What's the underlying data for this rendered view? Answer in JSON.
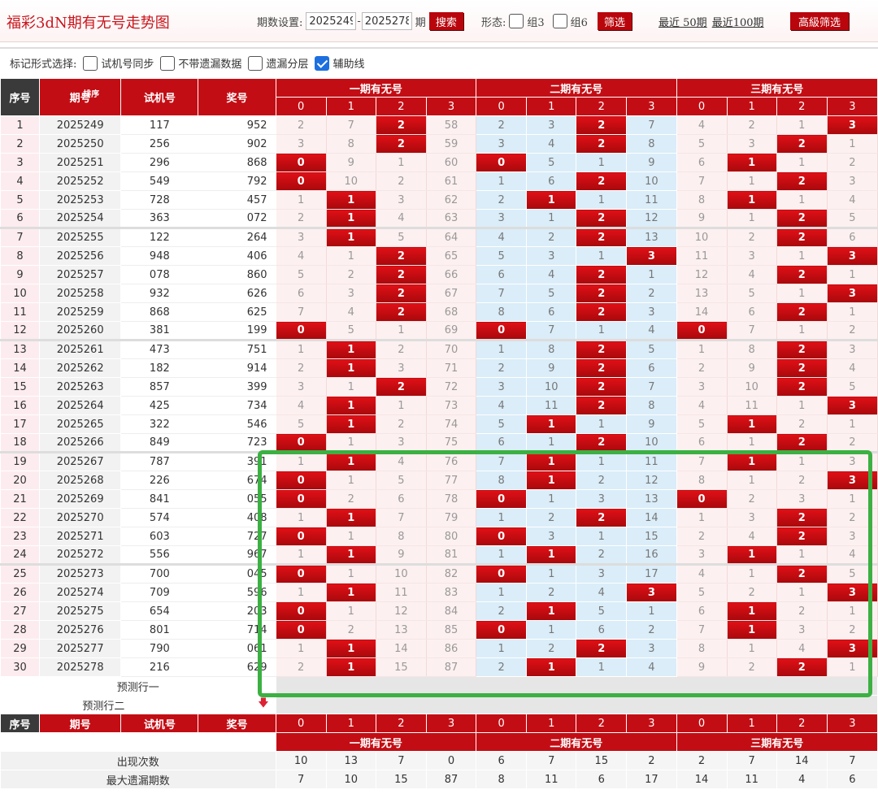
{
  "header": {
    "title": "福彩3dN期有无号走势图",
    "period_label": "期数设置:",
    "period_from": "2025249",
    "period_to": "2025278",
    "period_unit": "期",
    "search_label": "搜索",
    "form_label": "形态:",
    "form_opt1": "组3",
    "form_opt2": "组6",
    "filter_label": "筛选",
    "recent50": "最近 50期",
    "recent100": "最近100期",
    "adv_filter": "高級筛选"
  },
  "mark": {
    "label": "标记形式选择:",
    "opt1": "试机号同步",
    "opt2": "不带遗漏数据",
    "opt3": "遗漏分层",
    "opt4": "辅助线",
    "opt4_checked": true
  },
  "table": {
    "col_seq": "序号",
    "col_period": "期号",
    "col_sort": "排序",
    "col_test": "试机号",
    "col_draw": "奖号",
    "groups": [
      "一期有无号",
      "二期有无号",
      "三期有无号"
    ],
    "digits": [
      "0",
      "1",
      "2",
      "3"
    ],
    "pred1": "预测行一",
    "pred2": "预测行二",
    "stat_labels": [
      "出现次数",
      "最大遗漏期数"
    ],
    "stats": [
      [
        "10",
        "13",
        "7",
        "0",
        "6",
        "7",
        "15",
        "2",
        "2",
        "7",
        "14",
        "7"
      ],
      [
        "7",
        "10",
        "15",
        "87",
        "8",
        "11",
        "6",
        "17",
        "14",
        "11",
        "4",
        "6"
      ]
    ],
    "rows": [
      {
        "s": "1",
        "p": "2025249",
        "t": "117",
        "d": "952",
        "v": [
          "2",
          "7",
          "2",
          "58",
          "2",
          "3",
          "2",
          "7",
          "4",
          "2",
          "1",
          "3"
        ],
        "h": [
          2,
          6,
          11
        ]
      },
      {
        "s": "2",
        "p": "2025250",
        "t": "256",
        "d": "902",
        "v": [
          "3",
          "8",
          "2",
          "59",
          "3",
          "4",
          "2",
          "8",
          "5",
          "3",
          "2",
          "1"
        ],
        "h": [
          2,
          6,
          10
        ]
      },
      {
        "s": "3",
        "p": "2025251",
        "t": "296",
        "d": "868",
        "v": [
          "0",
          "9",
          "1",
          "60",
          "0",
          "5",
          "1",
          "9",
          "6",
          "1",
          "1",
          "2"
        ],
        "h": [
          0,
          4,
          9
        ]
      },
      {
        "s": "4",
        "p": "2025252",
        "t": "549",
        "d": "792",
        "v": [
          "0",
          "10",
          "2",
          "61",
          "1",
          "6",
          "2",
          "10",
          "7",
          "1",
          "2",
          "3"
        ],
        "h": [
          0,
          6,
          10
        ]
      },
      {
        "s": "5",
        "p": "2025253",
        "t": "728",
        "d": "457",
        "v": [
          "1",
          "1",
          "3",
          "62",
          "2",
          "1",
          "1",
          "11",
          "8",
          "1",
          "1",
          "4"
        ],
        "h": [
          1,
          5,
          9
        ]
      },
      {
        "s": "6",
        "p": "2025254",
        "t": "363",
        "d": "072",
        "v": [
          "2",
          "1",
          "4",
          "63",
          "3",
          "1",
          "2",
          "12",
          "9",
          "1",
          "2",
          "5"
        ],
        "h": [
          1,
          6,
          10
        ]
      },
      {
        "s": "7",
        "p": "2025255",
        "t": "122",
        "d": "264",
        "v": [
          "3",
          "1",
          "5",
          "64",
          "4",
          "2",
          "2",
          "13",
          "10",
          "2",
          "2",
          "6"
        ],
        "h": [
          1,
          6,
          10
        ]
      },
      {
        "s": "8",
        "p": "2025256",
        "t": "948",
        "d": "406",
        "v": [
          "4",
          "1",
          "2",
          "65",
          "5",
          "3",
          "1",
          "3",
          "11",
          "3",
          "1",
          "3"
        ],
        "h": [
          2,
          7,
          11
        ]
      },
      {
        "s": "9",
        "p": "2025257",
        "t": "078",
        "d": "860",
        "v": [
          "5",
          "2",
          "2",
          "66",
          "6",
          "4",
          "2",
          "1",
          "12",
          "4",
          "2",
          "1"
        ],
        "h": [
          2,
          6,
          10
        ]
      },
      {
        "s": "10",
        "p": "2025258",
        "t": "932",
        "d": "626",
        "v": [
          "6",
          "3",
          "2",
          "67",
          "7",
          "5",
          "2",
          "2",
          "13",
          "5",
          "1",
          "3"
        ],
        "h": [
          2,
          6,
          11
        ]
      },
      {
        "s": "11",
        "p": "2025259",
        "t": "868",
        "d": "625",
        "v": [
          "7",
          "4",
          "2",
          "68",
          "8",
          "6",
          "2",
          "3",
          "14",
          "6",
          "2",
          "1"
        ],
        "h": [
          2,
          6,
          10
        ]
      },
      {
        "s": "12",
        "p": "2025260",
        "t": "381",
        "d": "199",
        "v": [
          "0",
          "5",
          "1",
          "69",
          "0",
          "7",
          "1",
          "4",
          "0",
          "7",
          "1",
          "2"
        ],
        "h": [
          0,
          4,
          8
        ]
      },
      {
        "s": "13",
        "p": "2025261",
        "t": "473",
        "d": "751",
        "v": [
          "1",
          "1",
          "2",
          "70",
          "1",
          "8",
          "2",
          "5",
          "1",
          "8",
          "2",
          "3"
        ],
        "h": [
          1,
          6,
          10
        ]
      },
      {
        "s": "14",
        "p": "2025262",
        "t": "182",
        "d": "914",
        "v": [
          "2",
          "1",
          "3",
          "71",
          "2",
          "9",
          "2",
          "6",
          "2",
          "9",
          "2",
          "4"
        ],
        "h": [
          1,
          6,
          10
        ]
      },
      {
        "s": "15",
        "p": "2025263",
        "t": "857",
        "d": "399",
        "v": [
          "3",
          "1",
          "2",
          "72",
          "3",
          "10",
          "2",
          "7",
          "3",
          "10",
          "2",
          "5"
        ],
        "h": [
          2,
          6,
          10
        ]
      },
      {
        "s": "16",
        "p": "2025264",
        "t": "425",
        "d": "734",
        "v": [
          "4",
          "1",
          "1",
          "73",
          "4",
          "11",
          "2",
          "8",
          "4",
          "11",
          "1",
          "3"
        ],
        "h": [
          1,
          6,
          11
        ]
      },
      {
        "s": "17",
        "p": "2025265",
        "t": "322",
        "d": "546",
        "v": [
          "5",
          "1",
          "2",
          "74",
          "5",
          "1",
          "1",
          "9",
          "5",
          "1",
          "2",
          "1"
        ],
        "h": [
          1,
          5,
          9
        ]
      },
      {
        "s": "18",
        "p": "2025266",
        "t": "849",
        "d": "723",
        "v": [
          "0",
          "1",
          "3",
          "75",
          "6",
          "1",
          "2",
          "10",
          "6",
          "1",
          "2",
          "2"
        ],
        "h": [
          0,
          6,
          10
        ]
      },
      {
        "s": "19",
        "p": "2025267",
        "t": "787",
        "d": "391",
        "v": [
          "1",
          "1",
          "4",
          "76",
          "7",
          "1",
          "1",
          "11",
          "7",
          "1",
          "1",
          "3"
        ],
        "h": [
          1,
          5,
          9
        ]
      },
      {
        "s": "20",
        "p": "2025268",
        "t": "226",
        "d": "674",
        "v": [
          "0",
          "1",
          "5",
          "77",
          "8",
          "1",
          "2",
          "12",
          "8",
          "1",
          "2",
          "3"
        ],
        "h": [
          0,
          5,
          11
        ]
      },
      {
        "s": "21",
        "p": "2025269",
        "t": "841",
        "d": "055",
        "v": [
          "0",
          "2",
          "6",
          "78",
          "0",
          "1",
          "3",
          "13",
          "0",
          "2",
          "3",
          "1"
        ],
        "h": [
          0,
          4,
          8
        ]
      },
      {
        "s": "22",
        "p": "2025270",
        "t": "574",
        "d": "408",
        "v": [
          "1",
          "1",
          "7",
          "79",
          "1",
          "2",
          "2",
          "14",
          "1",
          "3",
          "2",
          "2"
        ],
        "h": [
          1,
          6,
          10
        ]
      },
      {
        "s": "23",
        "p": "2025271",
        "t": "603",
        "d": "727",
        "v": [
          "0",
          "1",
          "8",
          "80",
          "0",
          "3",
          "1",
          "15",
          "2",
          "4",
          "2",
          "3"
        ],
        "h": [
          0,
          4,
          10
        ]
      },
      {
        "s": "24",
        "p": "2025272",
        "t": "556",
        "d": "967",
        "v": [
          "1",
          "1",
          "9",
          "81",
          "1",
          "1",
          "2",
          "16",
          "3",
          "1",
          "1",
          "4"
        ],
        "h": [
          1,
          5,
          9
        ]
      },
      {
        "s": "25",
        "p": "2025273",
        "t": "700",
        "d": "045",
        "v": [
          "0",
          "1",
          "10",
          "82",
          "0",
          "1",
          "3",
          "17",
          "4",
          "1",
          "2",
          "5"
        ],
        "h": [
          0,
          4,
          10
        ]
      },
      {
        "s": "26",
        "p": "2025274",
        "t": "709",
        "d": "596",
        "v": [
          "1",
          "1",
          "11",
          "83",
          "1",
          "2",
          "4",
          "3",
          "5",
          "2",
          "1",
          "3"
        ],
        "h": [
          1,
          7,
          11
        ]
      },
      {
        "s": "27",
        "p": "2025275",
        "t": "654",
        "d": "203",
        "v": [
          "0",
          "1",
          "12",
          "84",
          "2",
          "1",
          "5",
          "1",
          "6",
          "1",
          "2",
          "1"
        ],
        "h": [
          0,
          5,
          9
        ]
      },
      {
        "s": "28",
        "p": "2025276",
        "t": "801",
        "d": "714",
        "v": [
          "0",
          "2",
          "13",
          "85",
          "0",
          "1",
          "6",
          "2",
          "7",
          "1",
          "3",
          "2"
        ],
        "h": [
          0,
          4,
          9
        ]
      },
      {
        "s": "29",
        "p": "2025277",
        "t": "790",
        "d": "061",
        "v": [
          "1",
          "1",
          "14",
          "86",
          "1",
          "2",
          "2",
          "3",
          "8",
          "1",
          "4",
          "3"
        ],
        "h": [
          1,
          6,
          11
        ]
      },
      {
        "s": "30",
        "p": "2025278",
        "t": "216",
        "d": "629",
        "v": [
          "2",
          "1",
          "15",
          "87",
          "2",
          "1",
          "1",
          "4",
          "9",
          "2",
          "2",
          "1"
        ],
        "h": [
          1,
          5,
          10
        ]
      }
    ]
  }
}
